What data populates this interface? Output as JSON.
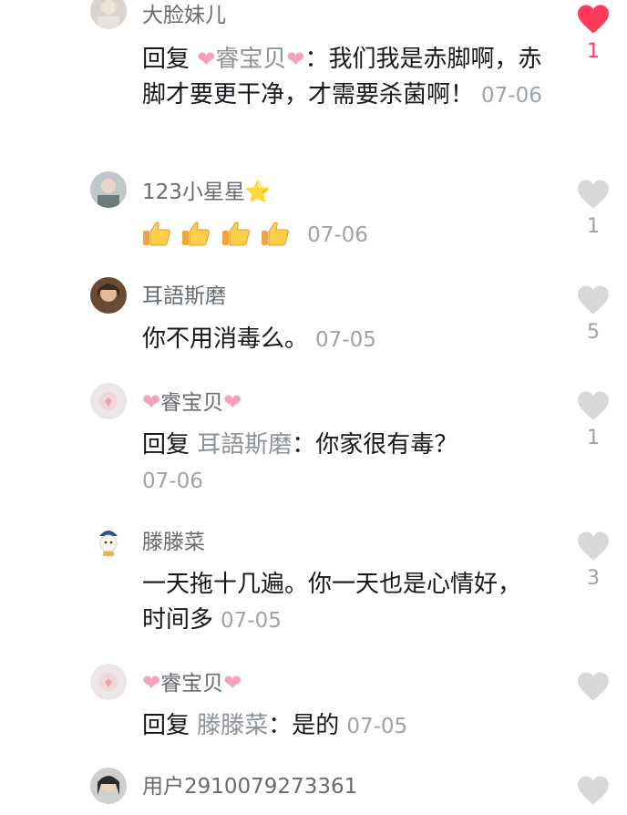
{
  "comments": [
    {
      "username": "大脸妹儿",
      "reply_prefix": "回复",
      "reply_to": "睿宝贝",
      "text": "：我们我是赤脚啊，赤脚才要更干净，才需要杀菌啊！",
      "time": "07-06",
      "likes": "1",
      "liked": true
    },
    {
      "username": "123小星星",
      "username_emoji": "⭐",
      "text_emoji": "thumbs-up x4",
      "time": "07-06",
      "likes": "1",
      "liked": false
    },
    {
      "username": "耳語斯磨",
      "text": "你不用消毒么。",
      "time": "07-05",
      "likes": "5",
      "liked": false
    },
    {
      "username": "睿宝贝",
      "reply_prefix": "回复",
      "reply_to": "耳語斯磨",
      "text": "：你家很有毒？",
      "time": "07-06",
      "likes": "1",
      "liked": false
    },
    {
      "username": "滕滕菜",
      "text": "一天拖十几遍。你一天也是心情好，时间多",
      "time": "07-05",
      "likes": "3",
      "liked": false
    },
    {
      "username": "睿宝贝",
      "reply_prefix": "回复",
      "reply_to": "滕滕菜",
      "text": "：是的",
      "time": "07-05",
      "likes": "",
      "liked": false
    },
    {
      "username": "用户2910079273361",
      "likes": "",
      "liked": false
    }
  ],
  "decor": {
    "pink_heart": "❤",
    "colors": {
      "liked": "#ff3b5c",
      "unliked": "#d8d8d8",
      "accent_pink": "#f6a0bd"
    }
  }
}
